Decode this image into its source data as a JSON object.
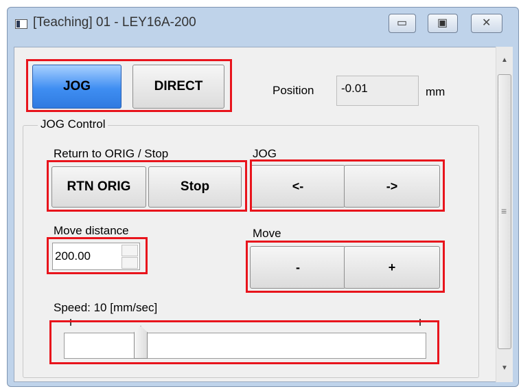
{
  "window": {
    "title": "[Teaching] 01 - LEY16A-200",
    "min_glyph": "▭",
    "max_glyph": "▣",
    "close_glyph": "✕"
  },
  "mode_tabs": {
    "jog": "JOG",
    "direct": "DIRECT"
  },
  "position": {
    "label": "Position",
    "value": "-0.01",
    "unit": "mm"
  },
  "jog_control": {
    "title": "JOG Control",
    "return_stop_label": "Return to ORIG / Stop",
    "rtn_orig_button": "RTN ORIG",
    "stop_button": "Stop",
    "jog_label": "JOG",
    "jog_left_button": "<-",
    "jog_right_button": "->",
    "move_distance_label": "Move distance",
    "move_distance_value": "200.00",
    "move_label": "Move",
    "move_minus_button": "-",
    "move_plus_button": "+",
    "speed_label": "Speed:  10 [mm/sec]",
    "speed_slider_fraction": 0.2
  },
  "scrollbar": {
    "up_glyph": "▲",
    "down_glyph": "▼",
    "grip_glyph": "≡"
  },
  "colors": {
    "highlight": "#e8141c",
    "active_tab": "#3f8ef2"
  }
}
